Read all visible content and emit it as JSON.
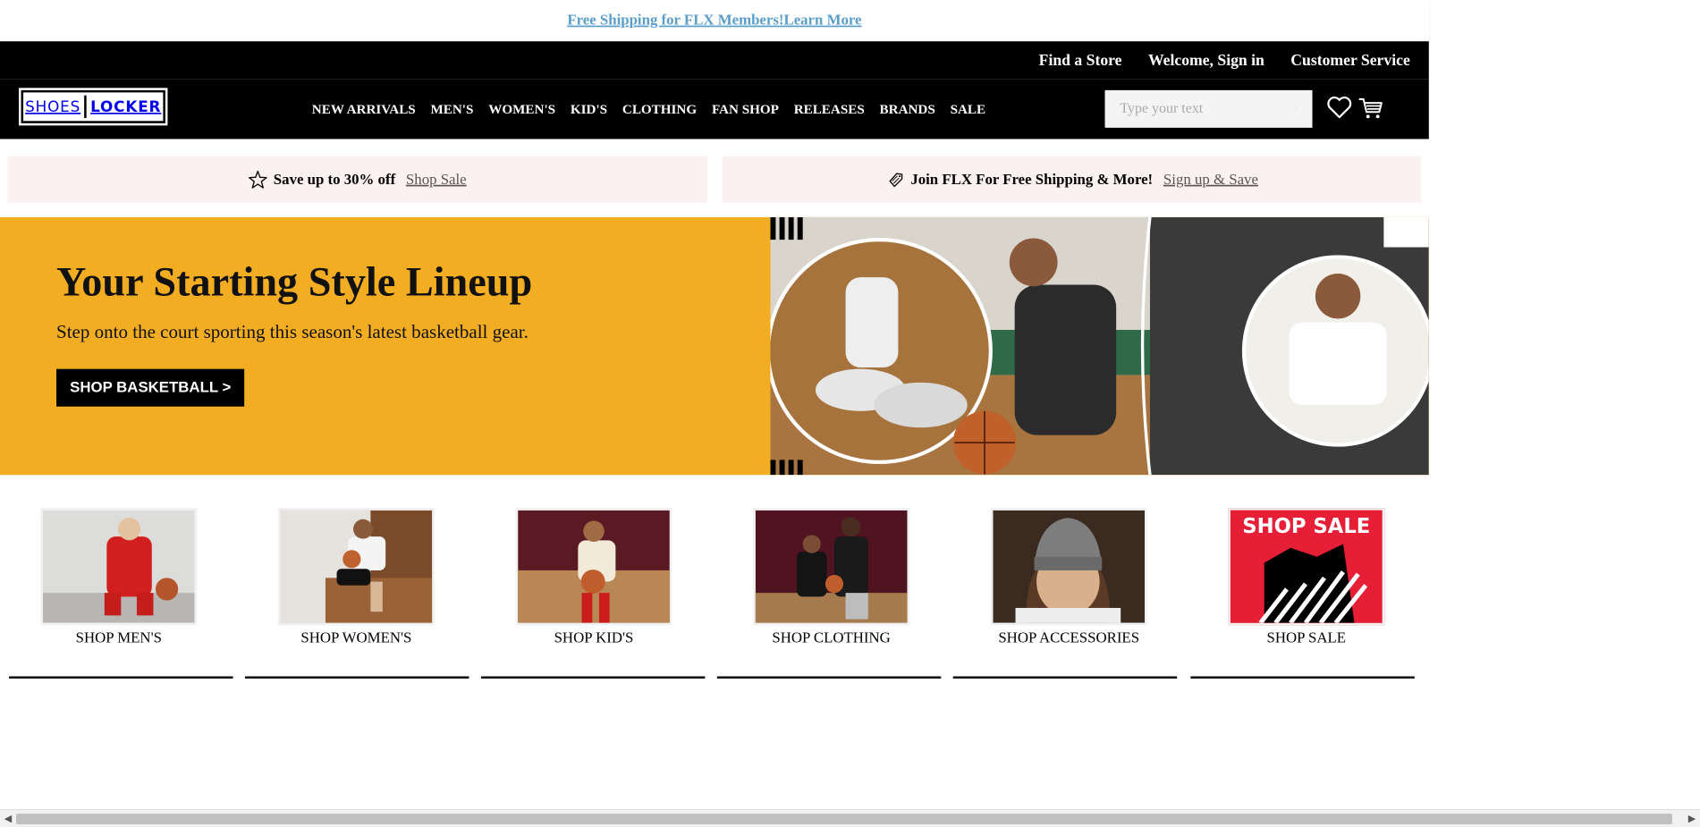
{
  "promo": {
    "text": "Free Shipping for FLX Members!Learn More"
  },
  "utility": {
    "find_store": "Find a Store",
    "sign_in": "Welcome, Sign in",
    "customer_service": "Customer Service"
  },
  "brand": {
    "left": "SHOES",
    "right": "LOCKER"
  },
  "nav": {
    "items": [
      "NEW ARRIVALS",
      "MEN'S",
      "WOMEN'S",
      "KID'S",
      "CLOTHING",
      "FAN SHOP",
      "RELEASES",
      "BRANDS",
      "SALE"
    ]
  },
  "search": {
    "placeholder": "Type your text"
  },
  "offers": {
    "sale": {
      "text": "Save up to 30% off",
      "link": "Shop Sale"
    },
    "flx": {
      "text": "Join FLX For Free Shipping & More!",
      "link": "Sign up & Save"
    }
  },
  "hero": {
    "title": "Your Starting Style Lineup",
    "subtitle": "Step onto the court sporting this season's latest basketball gear.",
    "cta": "SHOP BASKETBALL >"
  },
  "categories": [
    {
      "label": "SHOP MEN'S"
    },
    {
      "label": "SHOP WOMEN'S"
    },
    {
      "label": "SHOP KID'S"
    },
    {
      "label": "SHOP CLOTHING"
    },
    {
      "label": "SHOP ACCESSORIES"
    },
    {
      "label": "SHOP SALE",
      "thumb_text": "SHOP SALE"
    }
  ],
  "colors": {
    "accent": "#f2ad22",
    "link": "#5a9ec9",
    "offer_bg": "#fcf1f1",
    "sale_red": "#e61f36"
  }
}
